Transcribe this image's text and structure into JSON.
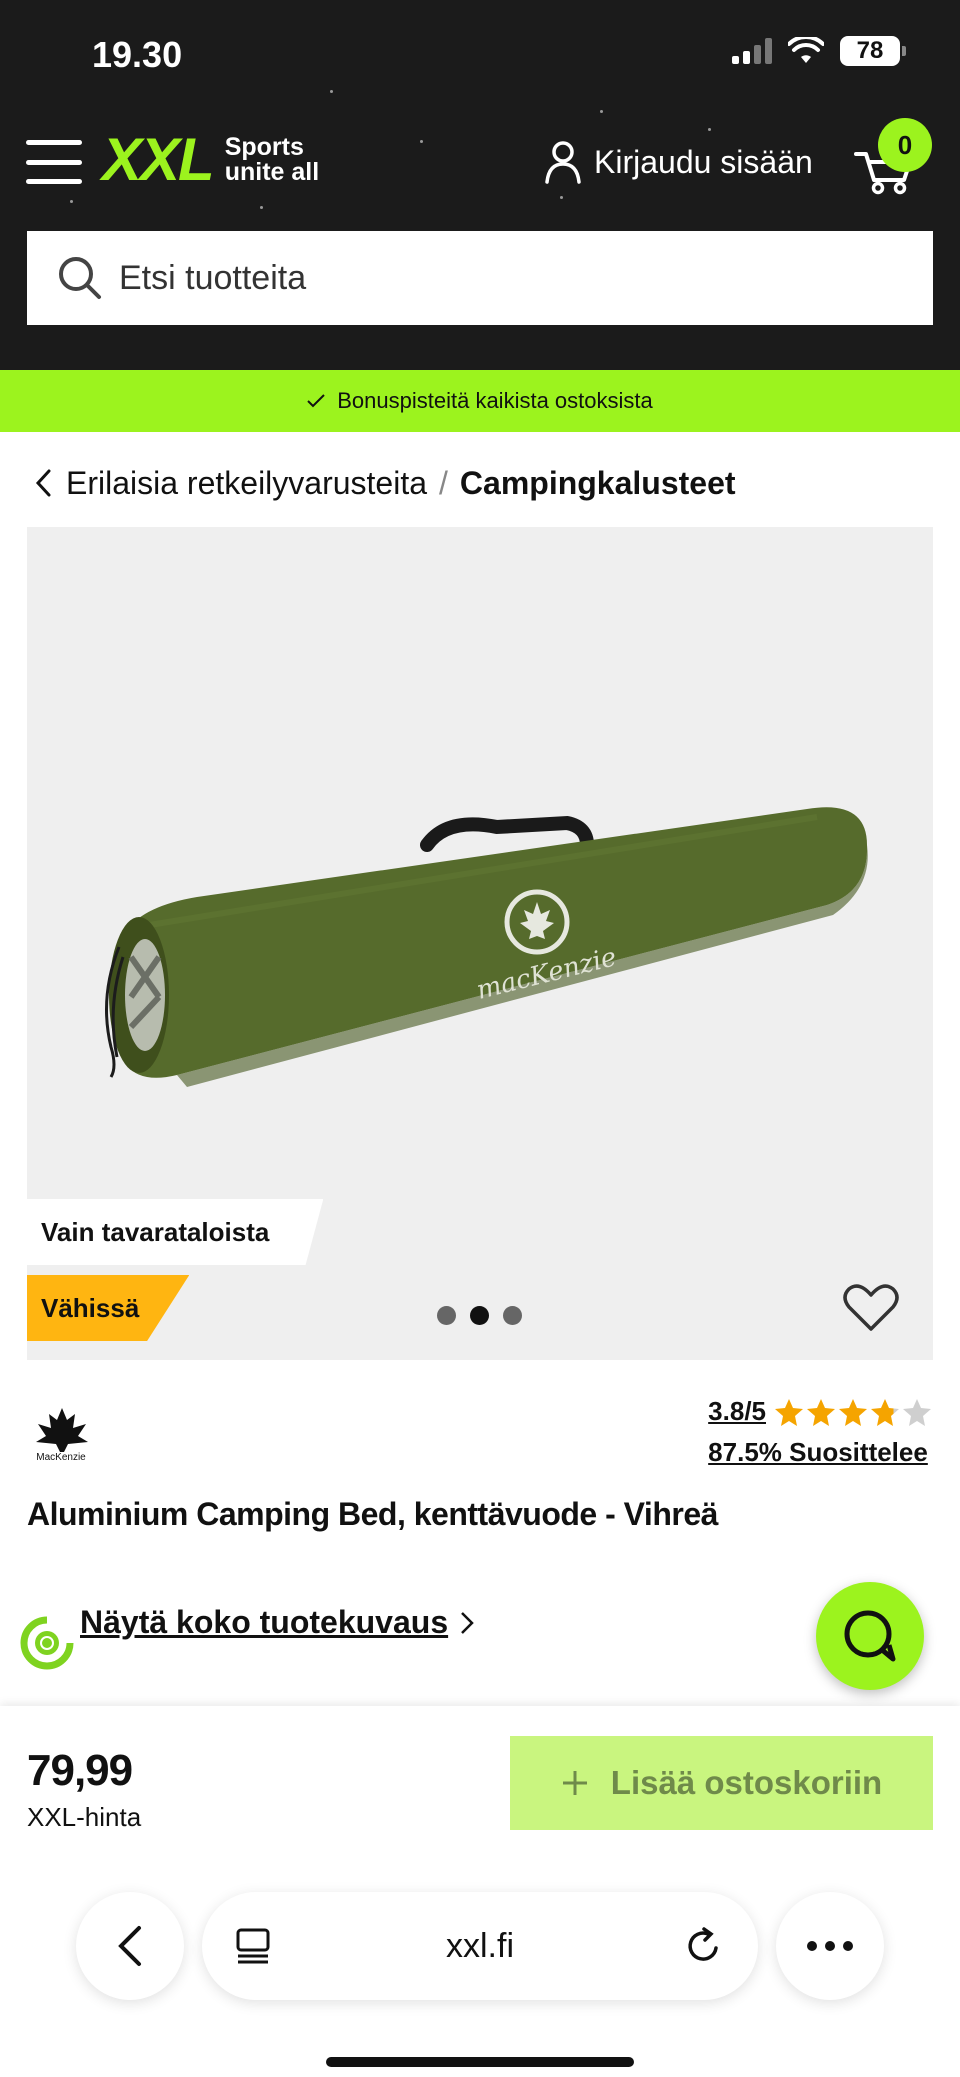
{
  "status_bar": {
    "time": "19.30",
    "battery": "78"
  },
  "header": {
    "logo_text": "XXL",
    "slogan_line1": "Sports",
    "slogan_line2": "unite all",
    "login_label": "Kirjaudu sisään",
    "cart_count": "0",
    "accent_color": "#9cf31e"
  },
  "search": {
    "placeholder": "Etsi tuotteita"
  },
  "promo": {
    "text": "Bonuspisteitä kaikista ostoksista"
  },
  "breadcrumb": {
    "parent": "Erilaisia retkeilyvarusteita",
    "separator": "/",
    "current": "Campingkalusteet"
  },
  "gallery": {
    "tag_store_only": "Vain tavarataloista",
    "tag_low_stock": "Vähissä",
    "bag_print": "macKenzie",
    "dots_total": 3,
    "active_dot": 2
  },
  "product": {
    "brand": "MacKenzie",
    "rating_score": "3.8/5",
    "rating_value": 3.8,
    "recommend": "87.5% Suosittelee",
    "title": "Aluminium Camping Bed, kenttävuode - Vihreä",
    "desc_link": "Näytä koko tuotekuvaus"
  },
  "purchase": {
    "price": "79,99",
    "price_label": "XXL-hinta",
    "add_to_cart": "Lisää ostoskoriin"
  },
  "browser": {
    "url": "xxl.fi"
  }
}
